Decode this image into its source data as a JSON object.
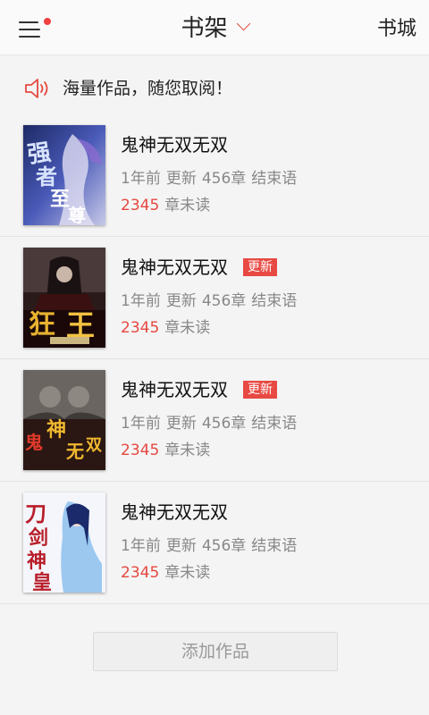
{
  "header": {
    "title": "书架",
    "store_label": "书城",
    "menu_has_notification": true,
    "accent_color": "#e5483f"
  },
  "notice": {
    "text": "海量作品，随您取阅！",
    "icon": "speaker-icon"
  },
  "books": [
    {
      "title": "鬼神无双无双",
      "badge": "",
      "time": "1年前",
      "update_prefix": "更新",
      "chapters": "456章",
      "last_chapter": "结束语",
      "unread_count": "2345",
      "unread_label": "章未读",
      "cover_text": "强者至尊"
    },
    {
      "title": "鬼神无双无双",
      "badge": "更新",
      "time": "1年前",
      "update_prefix": "更新",
      "chapters": "456章",
      "last_chapter": "结束语",
      "unread_count": "2345",
      "unread_label": "章未读",
      "cover_text": "狂王"
    },
    {
      "title": "鬼神无双无双",
      "badge": "更新",
      "time": "1年前",
      "update_prefix": "更新",
      "chapters": "456章",
      "last_chapter": "结束语",
      "unread_count": "2345",
      "unread_label": "章未读",
      "cover_text": "鬼神无双"
    },
    {
      "title": "鬼神无双无双",
      "badge": "",
      "time": "1年前",
      "update_prefix": "更新",
      "chapters": "456章",
      "last_chapter": "结束语",
      "unread_count": "2345",
      "unread_label": "章未读",
      "cover_text": "刀剑神皇"
    }
  ],
  "add_button_label": "添加作品"
}
